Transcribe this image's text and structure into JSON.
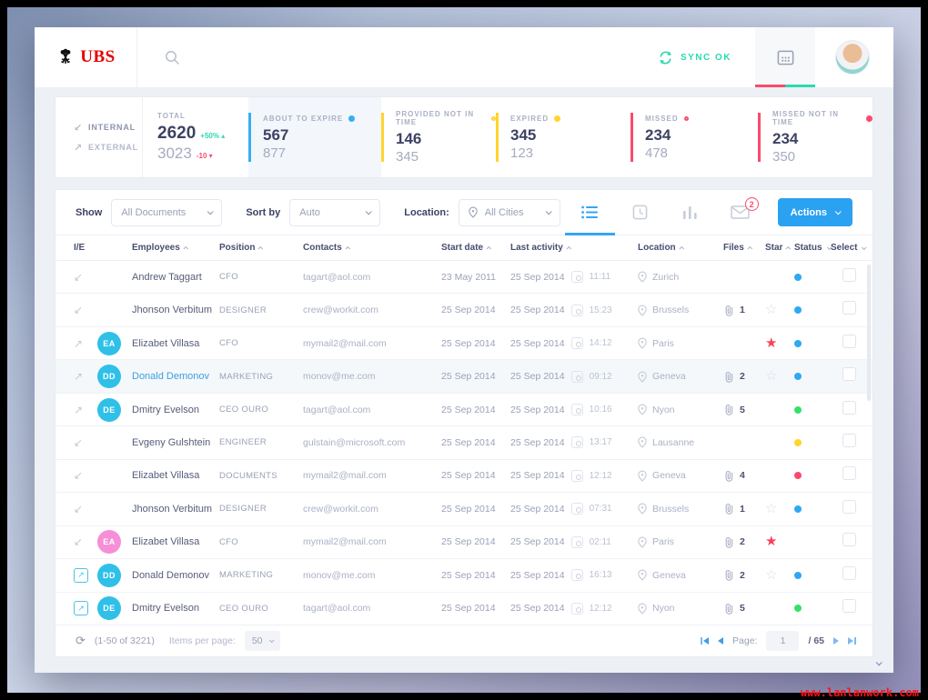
{
  "watermark": "www.lanlanwork.com",
  "header": {
    "brand": "UBS",
    "sync_label": "SYNC OK",
    "colors": {
      "sync": "#2bd9b0",
      "cal_bar_red": "#fb4b6b",
      "cal_bar_green": "#2bd9b0"
    }
  },
  "stats": {
    "internal_label": "INTERNAL",
    "external_label": "EXTERNAL",
    "total": {
      "label": "TOTAL",
      "internal": "2620",
      "internal_delta": "+50%",
      "external": "3023",
      "external_delta": "-10"
    },
    "cards": [
      {
        "label": "ABOUT TO EXPIRE",
        "value": "567",
        "secondary": "877",
        "accent": "#35aef4",
        "dot": "fill"
      },
      {
        "label": "PROVIDED NOT IN TIME",
        "value": "146",
        "secondary": "345",
        "accent": "#ffd42e",
        "dot": "ring"
      },
      {
        "label": "EXPIRED",
        "value": "345",
        "secondary": "123",
        "accent": "#ffd42e",
        "dot": "fill"
      },
      {
        "label": "MISSED",
        "value": "234",
        "secondary": "478",
        "accent": "#fb4b6b",
        "dot": "ring"
      },
      {
        "label": "MISSED NOT IN TIME",
        "value": "234",
        "secondary": "350",
        "accent": "#fb4b6b",
        "dot": "fill"
      }
    ]
  },
  "filters": {
    "show_label": "Show",
    "show_value": "All Documents",
    "sort_label": "Sort by",
    "sort_value": "Auto",
    "location_label": "Location:",
    "location_value": "All Cities",
    "mail_badge": "2",
    "actions_label": "Actions"
  },
  "table": {
    "columns": [
      {
        "label": "I/E",
        "sort": ""
      },
      {
        "label": "",
        "sort": ""
      },
      {
        "label": "Employees",
        "sort": "up"
      },
      {
        "label": "Position",
        "sort": "up"
      },
      {
        "label": "Contacts",
        "sort": "up"
      },
      {
        "label": "Start date",
        "sort": "up"
      },
      {
        "label": "Last activity",
        "sort": "up"
      },
      {
        "label": "Location",
        "sort": "up"
      },
      {
        "label": "Files",
        "sort": "up"
      },
      {
        "label": "Star",
        "sort": "up"
      },
      {
        "label": "Status",
        "sort": "down"
      },
      {
        "label": "Select",
        "sort": "down"
      }
    ],
    "status_colors": {
      "blue": "#2fa8f3",
      "green": "#35e06b",
      "yellow": "#ffd42e",
      "red": "#fb4b6b"
    },
    "rows": [
      {
        "dir": "in",
        "avatar": {
          "kind": "photo",
          "c1": "#e8b48a",
          "c2": "#6fb0d8"
        },
        "name": "Andrew Taggart",
        "active": false,
        "highlight": false,
        "position": "CFO",
        "contact": "tagart@aol.com",
        "start": "23 May 2011",
        "last_date": "25 Sep 2014",
        "last_time": "11:11",
        "city": "Zurich",
        "files": "",
        "star": "",
        "status": "blue"
      },
      {
        "dir": "in",
        "avatar": {
          "kind": "photo",
          "c1": "#4a3a32",
          "c2": "#8a7668"
        },
        "name": "Jhonson Verbitum",
        "active": false,
        "highlight": false,
        "position": "DESIGNER",
        "contact": "crew@workit.com",
        "start": "25 Sep 2014",
        "last_date": "25 Sep 2014",
        "last_time": "15:23",
        "city": "Brussels",
        "files": "1",
        "star": "outline",
        "status": "blue"
      },
      {
        "dir": "out",
        "avatar": {
          "kind": "init",
          "text": "EA",
          "bg": "#2fc0e8"
        },
        "name": "Elizabet Villasa",
        "active": false,
        "highlight": false,
        "position": "CFO",
        "contact": "mymail2@mail.com",
        "start": "25 Sep 2014",
        "last_date": "25 Sep 2014",
        "last_time": "14:12",
        "city": "Paris",
        "files": "",
        "star": "filled",
        "status": "blue"
      },
      {
        "dir": "out",
        "avatar": {
          "kind": "init",
          "text": "DD",
          "bg": "#2fc0e8"
        },
        "name": "Donald Demonov",
        "active": true,
        "highlight": true,
        "position": "MARKETING",
        "contact": "monov@me.com",
        "start": "25 Sep 2014",
        "last_date": "25 Sep 2014",
        "last_time": "09:12",
        "city": "Geneva",
        "files": "2",
        "star": "outline",
        "status": "blue"
      },
      {
        "dir": "out",
        "avatar": {
          "kind": "init",
          "text": "DE",
          "bg": "#2fc0e8"
        },
        "name": "Dmitry Evelson",
        "active": false,
        "highlight": false,
        "position": "CEO OURO",
        "contact": "tagart@aol.com",
        "start": "25 Sep 2014",
        "last_date": "25 Sep 2014",
        "last_time": "10:16",
        "city": "Nyon",
        "files": "5",
        "star": "",
        "status": "green"
      },
      {
        "dir": "in",
        "avatar": {
          "kind": "photo",
          "c1": "#7888c8",
          "c2": "#4a3a6a"
        },
        "name": "Evgeny Gulshtein",
        "active": false,
        "highlight": false,
        "position": "ENGINEER",
        "contact": "gulstain@microsoft.com",
        "start": "25 Sep 2014",
        "last_date": "25 Sep 2014",
        "last_time": "13:17",
        "city": "Lausanne",
        "files": "",
        "star": "",
        "status": "yellow"
      },
      {
        "dir": "in",
        "avatar": {
          "kind": "photo",
          "c1": "#6a584a",
          "c2": "#9a8878"
        },
        "name": "Elizabet Villasa",
        "active": false,
        "highlight": false,
        "position": "DOCUMENTS",
        "contact": "mymail2@mail.com",
        "start": "25 Sep 2014",
        "last_date": "25 Sep 2014",
        "last_time": "12:12",
        "city": "Geneva",
        "files": "4",
        "star": "",
        "status": "red"
      },
      {
        "dir": "in",
        "avatar": {
          "kind": "photo",
          "c1": "#4a3a32",
          "c2": "#8a7668"
        },
        "name": "Jhonson Verbitum",
        "active": false,
        "highlight": false,
        "position": "DESIGNER",
        "contact": "crew@workit.com",
        "start": "25 Sep 2014",
        "last_date": "25 Sep 2014",
        "last_time": "07:31",
        "city": "Brussels",
        "files": "1",
        "star": "outline",
        "status": "blue"
      },
      {
        "dir": "in",
        "avatar": {
          "kind": "init",
          "text": "EA",
          "bg": "#f48fd8"
        },
        "name": "Elizabet Villasa",
        "active": false,
        "highlight": false,
        "position": "CFO",
        "contact": "mymail2@mail.com",
        "start": "25 Sep 2014",
        "last_date": "25 Sep 2014",
        "last_time": "02:11",
        "city": "Paris",
        "files": "2",
        "star": "filled",
        "status": ""
      },
      {
        "dir": "link",
        "avatar": {
          "kind": "init",
          "text": "DD",
          "bg": "#2fc0e8"
        },
        "name": "Donald Demonov",
        "active": false,
        "highlight": false,
        "position": "MARKETING",
        "contact": "monov@me.com",
        "start": "25 Sep 2014",
        "last_date": "25 Sep 2014",
        "last_time": "16:13",
        "city": "Geneva",
        "files": "2",
        "star": "outline",
        "status": "blue"
      },
      {
        "dir": "link",
        "avatar": {
          "kind": "init",
          "text": "DE",
          "bg": "#2fc0e8"
        },
        "name": "Dmitry Evelson",
        "active": false,
        "highlight": false,
        "position": "CEO OURO",
        "contact": "tagart@aol.com",
        "start": "25 Sep 2014",
        "last_date": "25 Sep 2014",
        "last_time": "12:12",
        "city": "Nyon",
        "files": "5",
        "star": "",
        "status": "green"
      }
    ]
  },
  "footer": {
    "range": "(1-50 of 3221)",
    "items_per_page_label": "Items per page:",
    "items_per_page_value": "50",
    "page_label": "Page:",
    "page_value": "1",
    "page_total": "/ 65"
  }
}
